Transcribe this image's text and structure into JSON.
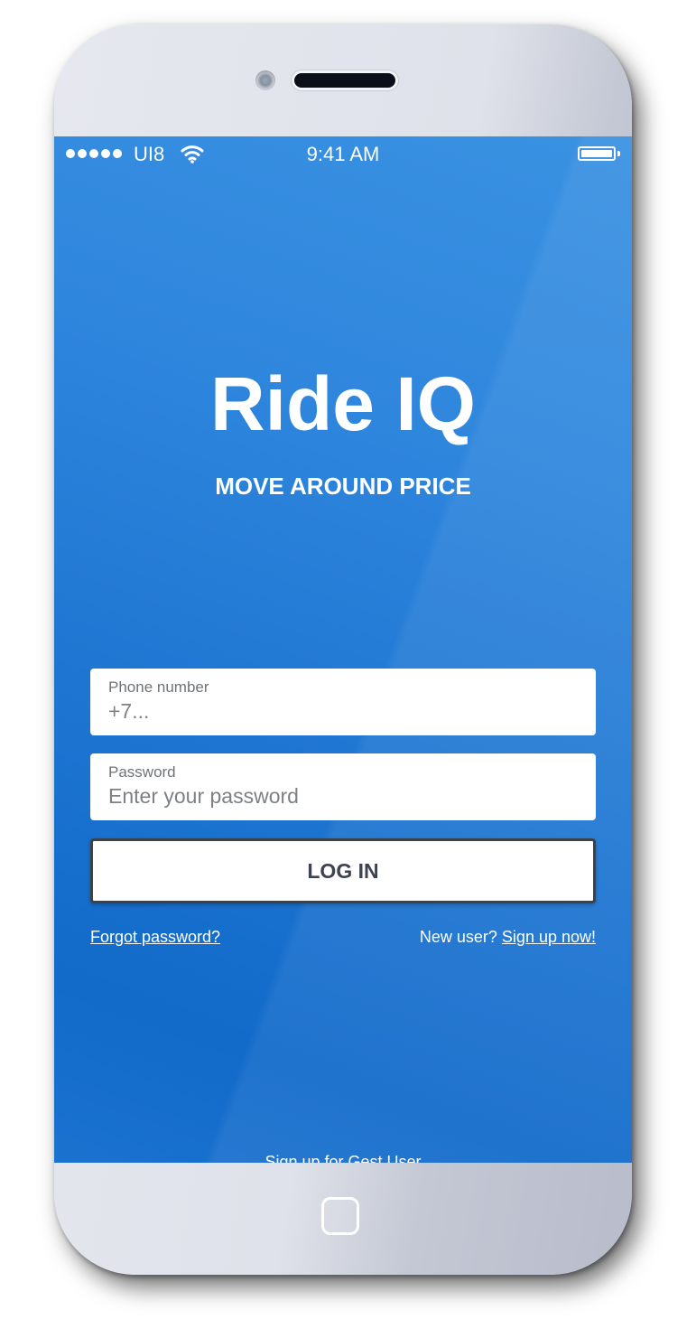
{
  "status_bar": {
    "carrier": "UI8",
    "time": "9:41 AM",
    "signal_bars": 5,
    "battery_level": 1.0,
    "icons": [
      "signal-dots-icon",
      "wifi-icon",
      "battery-icon"
    ]
  },
  "brand": {
    "title": "Ride IQ",
    "tagline": "MOVE AROUND PRICE"
  },
  "form": {
    "phone_label": "Phone number",
    "phone_placeholder": "+7...",
    "password_label": "Password",
    "password_placeholder": "Enter your password",
    "login_label": "LOG IN"
  },
  "links": {
    "forgot_password": "Forgot password?",
    "new_user_prefix": "New user?",
    "sign_up": "Sign up now!",
    "guest_signup": "Sign up for Gest User"
  },
  "colors": {
    "screen_top": "#3a92e2",
    "screen_bottom": "#126ac9",
    "button_text": "#3d4350",
    "button_border": "#3d4148",
    "text_on_blue": "#ffffff"
  }
}
